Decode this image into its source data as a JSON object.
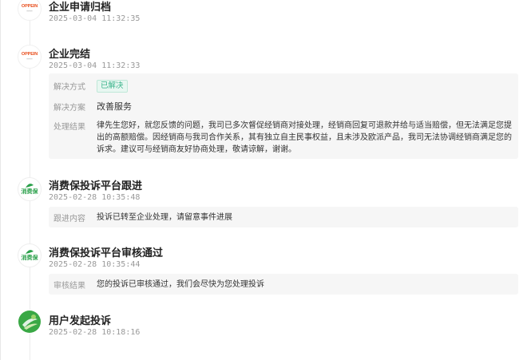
{
  "events": [
    {
      "title": "企业申请归档",
      "time": "2025-03-04 11:32:35",
      "icon": "oppein-logo-icon",
      "brand": "OPPEIN"
    },
    {
      "title": "企业完结",
      "time": "2025-03-04 11:32:33",
      "icon": "oppein-logo-icon",
      "brand": "OPPEIN",
      "details": {
        "method_label": "解决方式",
        "method_value": "已解决",
        "plan_label": "解决方案",
        "plan_value": "改善服务",
        "result_label": "处理结果",
        "result_value": "律先生您好，就您反馈的问题，我司已多次督促经销商对接处理，经销商回复可退款并给与适当赔偿，但无法满足您提出的高额赔偿。因经销商与我司合作关系，其有独立自主民事权益，且未涉及欧派产品，我司无法协调经销商满足您的诉求。建议可与经销商友好协商处理，敬请谅解，谢谢。"
      }
    },
    {
      "title": "消费保投诉平台跟进",
      "time": "2025-02-28 10:35:48",
      "icon": "xiaofeibao-logo-icon",
      "brand": "消费保",
      "details": {
        "label": "跟进内容",
        "value": "投诉已转至企业处理，请留意事件进展"
      }
    },
    {
      "title": "消费保投诉平台审核通过",
      "time": "2025-02-28 10:35:44",
      "icon": "xiaofeibao-logo-icon",
      "brand": "消费保",
      "details": {
        "label": "审核结果",
        "value": "您的投诉已审核通过，我们会尽快为您处理投诉"
      }
    },
    {
      "title": "用户发起投诉",
      "time": "2025-02-28 10:18:16",
      "icon": "user-green-logo-icon"
    }
  ],
  "colors": {
    "badge_green": "#39b38a",
    "oppein_orange": "#e84c1a",
    "xfb_green": "#2aa04a"
  }
}
